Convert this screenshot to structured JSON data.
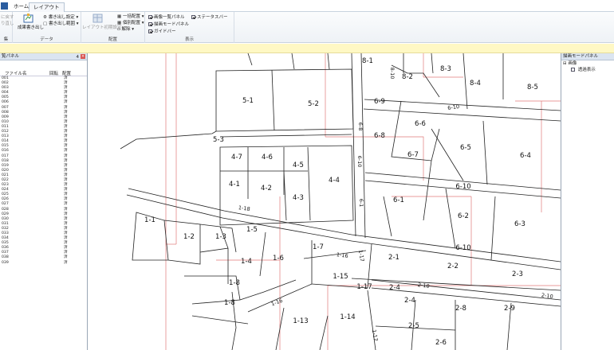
{
  "ribbon": {
    "tabs": [
      {
        "label": "ホーム",
        "active": false
      },
      {
        "label": "レイアウト",
        "active": true
      }
    ],
    "groups": {
      "g0": {
        "label": "集",
        "items": [
          "に戻す",
          "り直し"
        ]
      },
      "data": {
        "label": "データ",
        "big_button": "成果書き出し",
        "items": [
          "書き出し設定",
          "書き出し範囲"
        ]
      },
      "layout": {
        "label": "配置",
        "big_button": "レイアウト初期設定",
        "items": [
          "一括配置",
          "個別配置",
          "解除"
        ]
      },
      "display": {
        "label": "表示",
        "checks": [
          {
            "label": "画像一覧パネル",
            "checked": true
          },
          {
            "label": "ステータスバー",
            "checked": true
          },
          {
            "label": "描画モードパネル",
            "checked": true
          },
          {
            "label": "ガイドバー",
            "checked": true
          }
        ]
      }
    }
  },
  "left_panel": {
    "title": "覧パネル",
    "pin": "4",
    "columns": [
      "ファイル名",
      "回転",
      "配置"
    ],
    "rows": [
      {
        "name": "001",
        "rot": "",
        "placed": "済"
      },
      {
        "name": "002",
        "rot": "",
        "placed": "済"
      },
      {
        "name": "003",
        "rot": "",
        "placed": "済"
      },
      {
        "name": "004",
        "rot": "",
        "placed": "済"
      },
      {
        "name": "005",
        "rot": "",
        "placed": "済"
      },
      {
        "name": "006",
        "rot": "",
        "placed": "済"
      },
      {
        "name": "007",
        "rot": "",
        "placed": "済"
      },
      {
        "name": "008",
        "rot": "",
        "placed": "済"
      },
      {
        "name": "009",
        "rot": "",
        "placed": "済"
      },
      {
        "name": "010",
        "rot": "",
        "placed": "済"
      },
      {
        "name": "011",
        "rot": "",
        "placed": "済"
      },
      {
        "name": "012",
        "rot": "",
        "placed": "済"
      },
      {
        "name": "013",
        "rot": "",
        "placed": "済"
      },
      {
        "name": "014",
        "rot": "",
        "placed": "済"
      },
      {
        "name": "015",
        "rot": "",
        "placed": "済"
      },
      {
        "name": "016",
        "rot": "",
        "placed": "済"
      },
      {
        "name": "017",
        "rot": "",
        "placed": "済"
      },
      {
        "name": "018",
        "rot": "",
        "placed": "済"
      },
      {
        "name": "019",
        "rot": "",
        "placed": "済"
      },
      {
        "name": "020",
        "rot": "",
        "placed": "済"
      },
      {
        "name": "021",
        "rot": "",
        "placed": "済"
      },
      {
        "name": "022",
        "rot": "",
        "placed": "済"
      },
      {
        "name": "023",
        "rot": "",
        "placed": "済"
      },
      {
        "name": "024",
        "rot": "",
        "placed": "済"
      },
      {
        "name": "025",
        "rot": "",
        "placed": "済"
      },
      {
        "name": "026",
        "rot": "",
        "placed": "済"
      },
      {
        "name": "027",
        "rot": "",
        "placed": "済"
      },
      {
        "name": "028",
        "rot": "",
        "placed": "済"
      },
      {
        "name": "029",
        "rot": "",
        "placed": "済"
      },
      {
        "name": "030",
        "rot": "",
        "placed": "済"
      },
      {
        "name": "031",
        "rot": "",
        "placed": "済"
      },
      {
        "name": "032",
        "rot": "",
        "placed": "済"
      },
      {
        "name": "033",
        "rot": "",
        "placed": "済"
      },
      {
        "name": "034",
        "rot": "",
        "placed": "済"
      },
      {
        "name": "035",
        "rot": "",
        "placed": "済"
      },
      {
        "name": "036",
        "rot": "",
        "placed": "済"
      },
      {
        "name": "037",
        "rot": "",
        "placed": "済"
      },
      {
        "name": "038",
        "rot": "",
        "placed": "済"
      },
      {
        "name": "039",
        "rot": "",
        "placed": "済"
      }
    ]
  },
  "map": {
    "parcel_labels": [
      "8-1",
      "8-2",
      "8-3",
      "8-4",
      "8-5",
      "5-1",
      "5-2",
      "6-9",
      "6-10",
      "6-6",
      "6-8",
      "5-3",
      "4-7",
      "4-6",
      "4-5",
      "6-7",
      "6-5",
      "6-4",
      "4-4",
      "4-1",
      "4-2",
      "4-3",
      "6-10",
      "6-1",
      "1-18",
      "6-2",
      "6-3",
      "1-1",
      "1-2",
      "1-3",
      "1-5",
      "1-7",
      "6-10",
      "1-16",
      "1-17",
      "2-1",
      "2-2",
      "2-3",
      "1-4",
      "1-6",
      "1-15",
      "1-8",
      "2-10",
      "1-17",
      "2-4",
      "2-10",
      "1-8",
      "1-16",
      "2-4",
      "2-8",
      "2-9",
      "1-13",
      "1-14",
      "2-5",
      "1-17",
      "2-6",
      "6-8",
      "6-10",
      "6-1",
      "8-10"
    ],
    "road_color": "#111111",
    "grid_color": "#e07a7a"
  },
  "right_panel": {
    "title": "描画モードパネル",
    "tree_root": "画像",
    "tree_child": "透過表示",
    "tree_child_checked": false
  }
}
